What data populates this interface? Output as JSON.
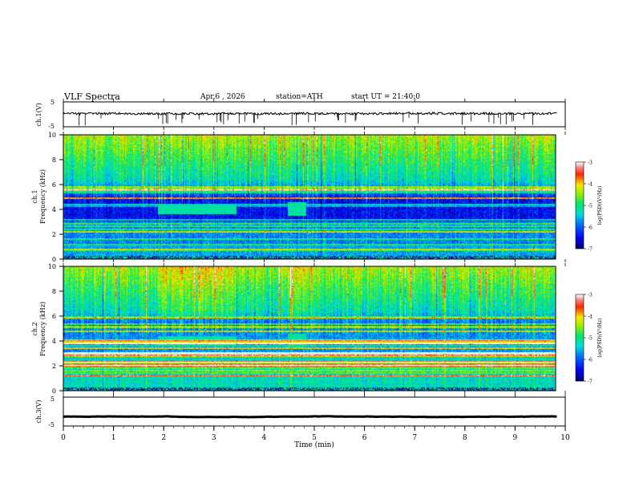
{
  "header": {
    "title": "VLF Spectra",
    "date": "Apr.6 , 2026",
    "station": "station=ATH",
    "start": "start UT = 21:40:0"
  },
  "colors": {
    "low": "#000080",
    "mid": "#00e070",
    "high": "#ff2a00",
    "top": "#ffffff"
  },
  "chart_data": [
    {
      "type": "line",
      "ylabel": "ch.1(V)",
      "ylim": [
        -5,
        5
      ],
      "yticks": [
        "5",
        "-5"
      ],
      "xlim": [
        0,
        9.83
      ],
      "baseline": 0.3,
      "noise": 0.9
    },
    {
      "type": "heatmap",
      "ylabel": "ch.1\nFrequency (kHz)",
      "xlim": [
        0,
        9.83
      ],
      "ylim": [
        0,
        10
      ],
      "yticks": [
        "0",
        "2",
        "4",
        "6",
        "8",
        "10"
      ],
      "colorbar": {
        "label": "log(PSD)(V²/Hz)",
        "range": [
          -7,
          -3
        ],
        "ticks": [
          "-3",
          "-4",
          "-5",
          "-6",
          "-7"
        ]
      },
      "events": [
        {
          "t_start": 1.88,
          "t_end": 3.45,
          "f_low": 3.6,
          "f_high": 4.4
        },
        {
          "t_start": 4.48,
          "t_end": 4.85,
          "f_low": 3.5,
          "f_high": 4.6
        }
      ]
    },
    {
      "type": "heatmap",
      "ylabel": "ch.2\nFrequency (kHz)",
      "xlim": [
        0,
        9.83
      ],
      "ylim": [
        0,
        10
      ],
      "yticks": [
        "0",
        "2",
        "4",
        "6",
        "8",
        "10"
      ],
      "colorbar": {
        "label": "log(PSD)(V²/Hz)",
        "range": [
          -7,
          -3
        ],
        "ticks": [
          "-3",
          "-4",
          "-5",
          "-6",
          "-7"
        ]
      },
      "events": [
        {
          "t_start": 1.88,
          "t_end": 3.45,
          "f_low": 3.6,
          "f_high": 4.4
        },
        {
          "t_start": 4.48,
          "t_end": 4.85,
          "f_low": 3.5,
          "f_high": 4.6
        }
      ]
    },
    {
      "type": "line",
      "ylabel": "ch.3(V)",
      "ylim": [
        -5,
        5
      ],
      "yticks": [
        "5",
        "-5"
      ],
      "xlim": [
        0,
        9.83
      ],
      "baseline": -1.8,
      "noise": 0.05
    }
  ],
  "xaxis": {
    "label": "Time (min)",
    "range": [
      0,
      10
    ],
    "ticks": [
      "0",
      "1",
      "2",
      "3",
      "4",
      "5",
      "6",
      "7",
      "8",
      "9",
      "10"
    ]
  }
}
